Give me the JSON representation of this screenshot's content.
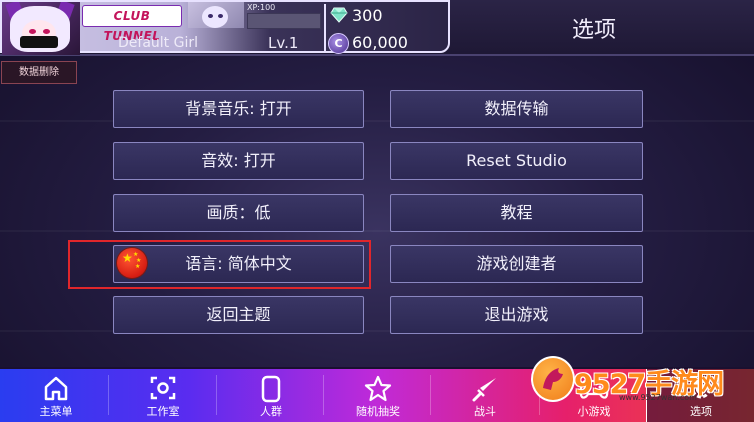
{
  "header": {
    "club_logo": "CLUB TUNNEL",
    "xp_label": "XP:100",
    "xp_progress": 0,
    "player_name": "Default Girl",
    "level": "Lv.1",
    "gems": "300",
    "coins": "60,000",
    "coin_symbol": "C",
    "screen_title": "选项"
  },
  "delete_data_label": "数据删除",
  "options_left": [
    "背景音乐: 打开",
    "音效: 打开",
    "画质：低",
    "语言: 简体中文",
    "返回主题"
  ],
  "options_right": [
    "数据传输",
    "Reset Studio",
    "教程",
    "游戏创建者",
    "退出游戏"
  ],
  "nav": [
    {
      "label": "主菜单",
      "icon": "home-icon"
    },
    {
      "label": "工作室",
      "icon": "camera-focus-icon"
    },
    {
      "label": "人群",
      "icon": "phone-icon"
    },
    {
      "label": "随机抽奖",
      "icon": "star-icon"
    },
    {
      "label": "战斗",
      "icon": "sword-icon"
    },
    {
      "label": "小游戏",
      "icon": "gamepad-icon"
    },
    {
      "label": "选项",
      "icon": "gear-icon"
    }
  ],
  "watermark": {
    "text": "9527手游网",
    "url": "www.9527wan.com"
  },
  "colors": {
    "highlight": "#e0262b",
    "button_border": "#8a86c0",
    "nav_gradient_start": "#2a3df0",
    "nav_gradient_end": "#f04a3a"
  }
}
